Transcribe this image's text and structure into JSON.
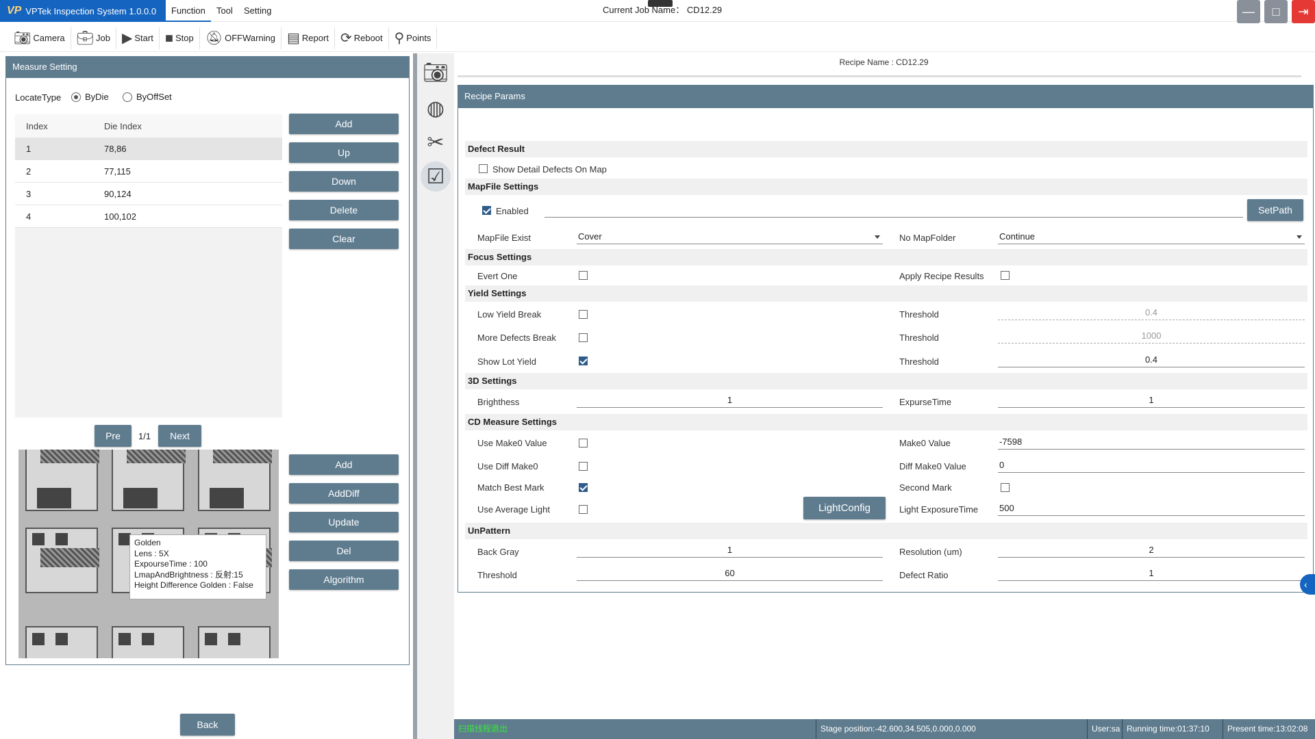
{
  "app": {
    "title": "VPTek Inspection System 1.0.0.0",
    "logo_text": "VP"
  },
  "menu": [
    "Function",
    "Tool",
    "Setting"
  ],
  "current_job": {
    "label": "Current Job Name：",
    "value": "CD12.29"
  },
  "window_buttons": {
    "minimize": "—",
    "maximize": "□",
    "exit": "⇥"
  },
  "toolbar": [
    {
      "label": "Camera",
      "icon": "camera-icon"
    },
    {
      "label": "Job",
      "icon": "briefcase-icon"
    },
    {
      "label": "Start",
      "icon": "play-icon"
    },
    {
      "label": "Stop",
      "icon": "stop-icon"
    },
    {
      "label": "OFFWarning",
      "icon": "bell-off-icon"
    },
    {
      "label": "Report",
      "icon": "report-icon"
    },
    {
      "label": "Reboot",
      "icon": "refresh-icon"
    },
    {
      "label": "Points",
      "icon": "pin-icon"
    }
  ],
  "measure": {
    "title": "Measure Setting",
    "locate_label": "LocateType",
    "options": [
      "ByDie",
      "ByOffSet"
    ],
    "selected": "ByDie",
    "columns": [
      "Index",
      "Die Index"
    ],
    "rows": [
      [
        "1",
        "78,86"
      ],
      [
        "2",
        "77,115"
      ],
      [
        "3",
        "90,124"
      ],
      [
        "4",
        "100,102"
      ]
    ],
    "buttons": [
      "Add",
      "Up",
      "Down",
      "Delete",
      "Clear"
    ],
    "pager": {
      "prev": "Pre",
      "page": "1/1",
      "next": "Next"
    },
    "image_buttons": [
      "Add",
      "AddDiff",
      "Update",
      "Del",
      "Algorithm"
    ],
    "tooltip": [
      "Golden",
      "Lens : 5X",
      "ExpourseTime : 100",
      "LmapAndBrightness : 反射:15",
      "Height Difference Golden : False"
    ],
    "back": "Back"
  },
  "recipe": {
    "name_label": "Recipe Name : CD12.29",
    "params_title": "Recipe Params",
    "defect": {
      "title": "Defect Result",
      "show_detail": "Show Detail Defects On Map",
      "show_detail_checked": false
    },
    "mapfile": {
      "title": "MapFile Settings",
      "enabled": "Enabled",
      "enabled_checked": true,
      "setpath": "SetPath",
      "exist_label": "MapFile Exist",
      "exist_value": "Cover",
      "nofolder_label": "No MapFolder",
      "nofolder_value": "Continue"
    },
    "focus": {
      "title": "Focus Settings",
      "evert_one": "Evert One",
      "evert_one_checked": false,
      "apply": "Apply Recipe Results",
      "apply_checked": false
    },
    "yield": {
      "title": "Yield Settings",
      "low": "Low Yield Break",
      "low_checked": false,
      "more": "More Defects Break",
      "more_checked": false,
      "show_lot": "Show Lot Yield",
      "show_lot_checked": true,
      "threshold_label": "Threshold",
      "threshold_low": "0.4",
      "threshold_more": "1000",
      "threshold_lot": "0.4"
    },
    "settings3d": {
      "title": "3D Settings",
      "brightness_label": "Brighthess",
      "brightness": "1",
      "exposure_label": "ExpurseTime",
      "exposure": "1"
    },
    "cd": {
      "title": "CD Measure Settings",
      "make0": "Use Make0 Value",
      "make0_checked": false,
      "diffmake0": "Use Diff Make0",
      "diffmake0_checked": false,
      "bestmark": "Match Best Mark",
      "bestmark_checked": true,
      "avglight": "Use Average Light",
      "avglight_checked": false,
      "make0_value_label": "Make0 Value",
      "make0_value": "-7598",
      "diff_value_label": "Diff Make0 Value",
      "diff_value": "0",
      "second_mark": "Second Mark",
      "second_mark_checked": false,
      "lightconfig": "LightConfig",
      "light_exp_label": "Light ExposureTime",
      "light_exp": "500"
    },
    "unpattern": {
      "title": "UnPattern",
      "backgray_label": "Back Gray",
      "backgray": "1",
      "resolution_label": "Resolution  (um)",
      "resolution": "2",
      "threshold_label": "Threshold",
      "threshold": "60",
      "ratio_label": "Defect Ratio",
      "ratio": "1"
    }
  },
  "status": {
    "message": "扫描线程退出",
    "stage": "Stage position:-42.600,34.505,0.000,0.000",
    "user": "User:sa",
    "running": "Running time:01:37:10",
    "present": "Present time:13:02:08"
  },
  "colors": {
    "accent": "#5f7c8f",
    "logo_bg": "#1565c0",
    "exit": "#e53935",
    "status_msg": "#39e639"
  }
}
